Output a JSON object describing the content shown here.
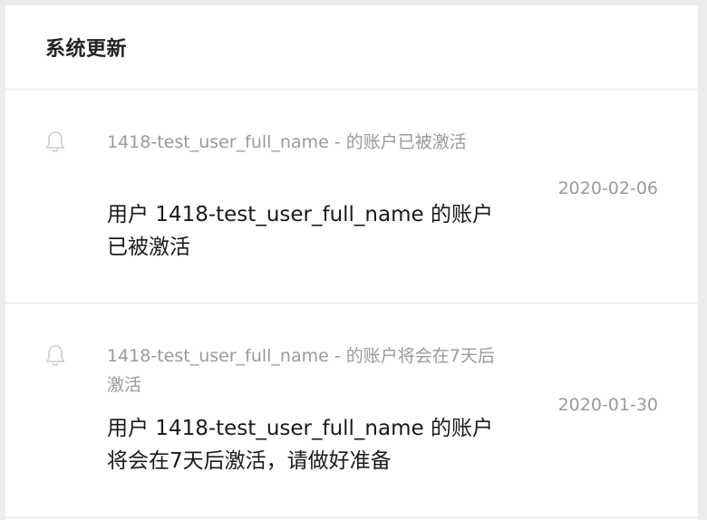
{
  "header": {
    "title": "系统更新"
  },
  "notifications": [
    {
      "icon": "bell-icon",
      "subtitle": "1418-test_user_full_name - 的账户已被激活",
      "body": "用户 1418-test_user_full_name 的账户已被激活",
      "date": "2020-02-06"
    },
    {
      "icon": "bell-icon",
      "subtitle": "1418-test_user_full_name - 的账户将会在7天后激活",
      "body": "用户 1418-test_user_full_name 的账户将会在7天后激活，请做好准备",
      "date": "2020-01-30"
    }
  ],
  "colors": {
    "background": "#ececec",
    "panel": "#ffffff",
    "title_text": "#222222",
    "body_text": "#1a1a1a",
    "muted_text": "#9a9a9a",
    "divider": "#e6e6e6"
  }
}
